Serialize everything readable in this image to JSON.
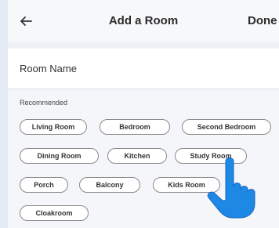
{
  "header": {
    "title": "Add a Room",
    "done_label": "Done",
    "back_icon": "arrow-left-icon"
  },
  "room_name": {
    "label": "Room Name"
  },
  "recommended": {
    "label": "Recommended",
    "chips": [
      "Living Room",
      "Bedroom",
      "Second Bedroom",
      "Dining Room",
      "Kitchen",
      "Study Room",
      "Porch",
      "Balcony",
      "Kids Room",
      "Cloakroom"
    ]
  },
  "pointer": {
    "icon": "pointing-hand-icon"
  },
  "colors": {
    "header_bg": "#f7f8fa",
    "section_bg": "#f4f6f9",
    "chip_border": "#8a8a8a",
    "hand": "#1e88e5"
  }
}
